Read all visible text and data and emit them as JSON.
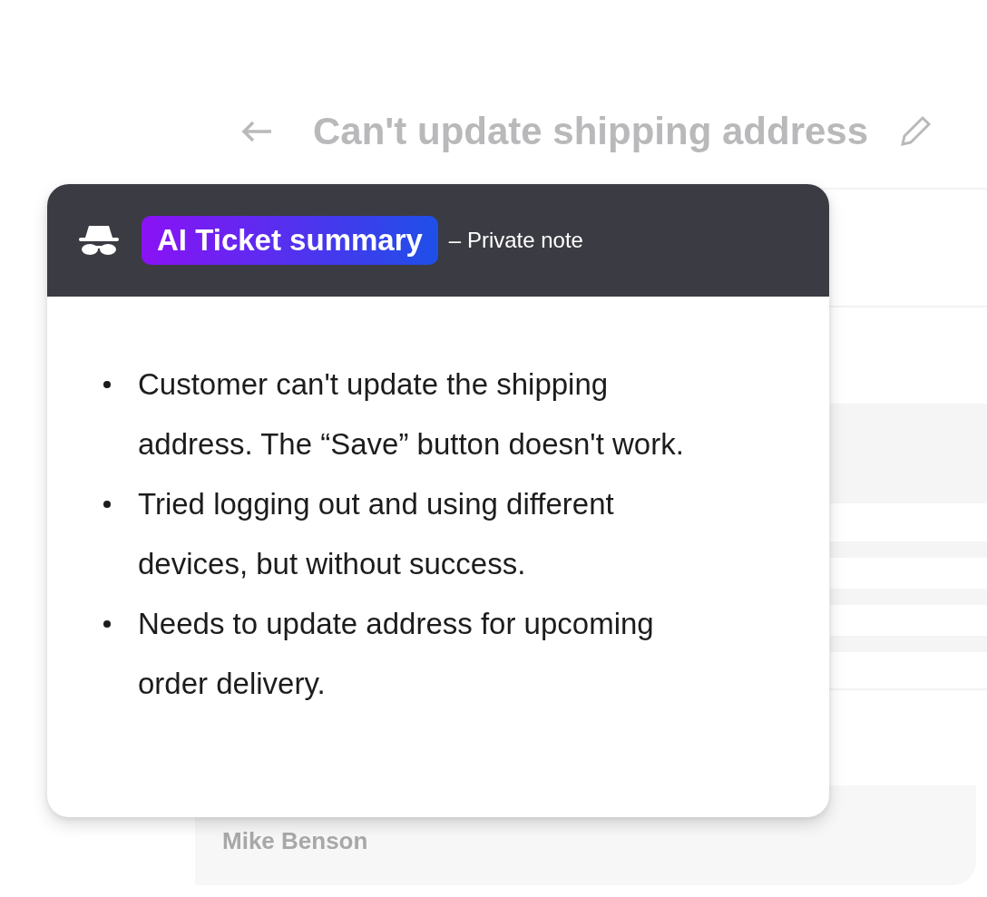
{
  "page": {
    "title": "Can't update shipping address",
    "requester": "Mike Benson"
  },
  "summary_card": {
    "badge": "AI Ticket summary",
    "note_type": "– Private note",
    "bullets": [
      "Customer can't update the shipping address. The “Save” button doesn't work.",
      "Tried logging out and using different devices, but without success.",
      "Needs to update address for upcoming order delivery."
    ]
  }
}
